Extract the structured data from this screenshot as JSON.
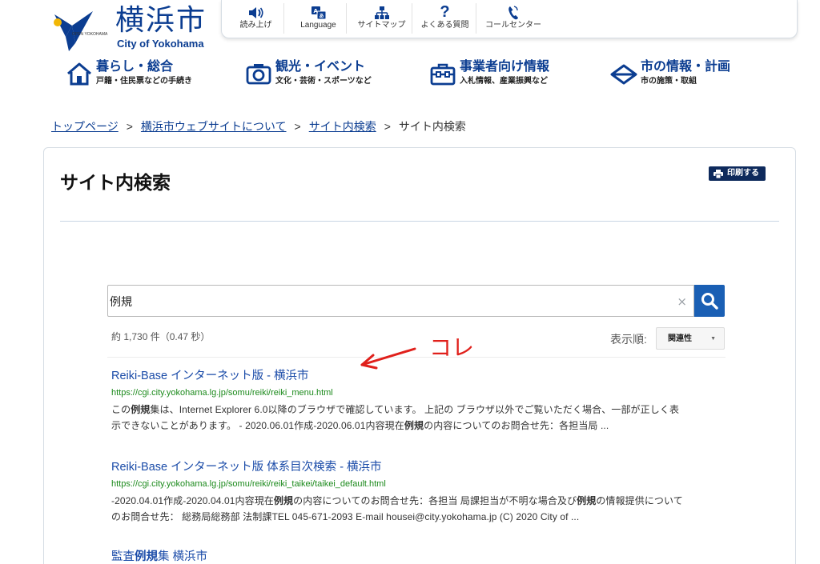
{
  "logo": {
    "jp": "横浜市",
    "en": "City of Yokohama",
    "open": "OPEN YOKOHAMA"
  },
  "utility_nav": [
    {
      "label": "読み上げ",
      "icon": "speaker-icon"
    },
    {
      "label": "Language",
      "icon": "translate-icon"
    },
    {
      "label": "サイトマップ",
      "icon": "sitemap-icon"
    },
    {
      "label": "よくある質問",
      "icon": "question-icon"
    },
    {
      "label": "コールセンター",
      "icon": "callcenter-icon"
    }
  ],
  "global_nav": [
    {
      "title": "暮らし・総合",
      "sub": "戸籍・住民票などの手続き",
      "icon": "house-icon"
    },
    {
      "title": "観光・イベント",
      "sub": "文化・芸術・スポーツなど",
      "icon": "camera-icon"
    },
    {
      "title": "事業者向け情報",
      "sub": "入札情報、産業振興など",
      "icon": "briefcase-icon"
    },
    {
      "title": "市の情報・計画",
      "sub": "市の施策・取組",
      "icon": "diamond-icon"
    }
  ],
  "breadcrumb": {
    "items": [
      "トップページ",
      "横浜市ウェブサイトについて",
      "サイト内検索"
    ],
    "current": "サイト内検索",
    "separator": ">"
  },
  "page": {
    "title": "サイト内検索",
    "print_label": "印刷する"
  },
  "search": {
    "query": "例規",
    "clear": "×",
    "result_count": "約 1,730 件（0.47 秒）",
    "sort_label": "表示順:",
    "sort_value": "関連性",
    "sort_caret": "▼"
  },
  "results": [
    {
      "title": "Reiki-Base インターネット版 - 横浜市",
      "url": "https://cgi.city.yokohama.lg.jp/somu/reiki/reiki_menu.html",
      "snippet_1a": "この",
      "snippet_1b": "例規",
      "snippet_1c": "集は、Internet Explorer 6.0以降のブラウザで確認しています。 上記の ブラウザ以外でご覧いただく場合、一部が正しく表",
      "snippet_2a": "示できないことがあります。 - 2020.06.01作成-2020.06.01内容現在",
      "snippet_2b": "例規",
      "snippet_2c": "の内容についてのお問合せ先：各担当局 ..."
    },
    {
      "title": "Reiki-Base インターネット版 体系目次検索 - 横浜市",
      "url": "https://cgi.city.yokohama.lg.jp/somu/reiki/reiki_taikei/taikei_default.html",
      "snippet_1a": "-2020.04.01作成-2020.04.01内容現在",
      "snippet_1b": "例規",
      "snippet_1c": "の内容についてのお問合せ先：各担当 局課担当が不明な場合及び",
      "snippet_1d": "例規",
      "snippet_1e": "の情報提供について",
      "snippet_2": "のお問合せ先： 総務局総務部 法制課TEL 045-671-2093 E-mail housei@city.yokohama.jp (C) 2020 City of ..."
    },
    {
      "title_a": "監査",
      "title_b": "例規",
      "title_c": "集 横浜市"
    }
  ],
  "annotation": {
    "text": "コレ",
    "color": "#e0201b"
  },
  "colors": {
    "brand": "#0b3d91",
    "link": "#1a4ba8",
    "url": "#1c8a1c",
    "search_button": "#1a5fb4",
    "print_button": "#0e2a5c"
  }
}
